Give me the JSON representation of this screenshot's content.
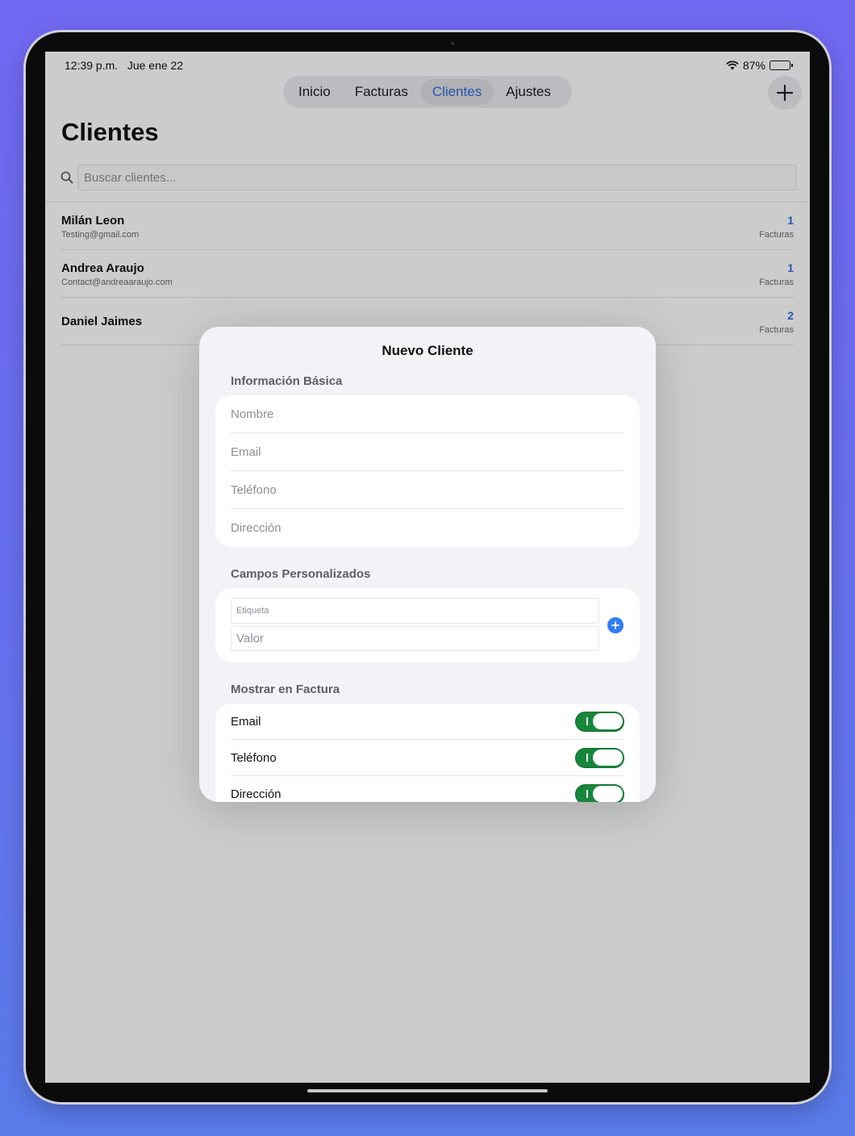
{
  "status_bar": {
    "time": "12:39 p.m.",
    "date": "Jue ene 22",
    "battery": "87%",
    "battery_level": 0.87
  },
  "nav": {
    "tabs": [
      {
        "label": "Inicio",
        "active": false
      },
      {
        "label": "Facturas",
        "active": false
      },
      {
        "label": "Clientes",
        "active": true
      },
      {
        "label": "Ajustes",
        "active": false
      }
    ],
    "add_icon": "plus-icon"
  },
  "page": {
    "title": "Clientes",
    "search_placeholder": "Buscar clientes..."
  },
  "clients": [
    {
      "name": "Milán Leon",
      "email": "Testing@gmail.com",
      "count": "1",
      "count_label": "Facturas"
    },
    {
      "name": "Andrea Araujo",
      "email": "Contact@andreaaraujo.com",
      "count": "1",
      "count_label": "Facturas"
    },
    {
      "name": "Daniel Jaimes",
      "email": "",
      "count": "2",
      "count_label": "Facturas"
    }
  ],
  "modal": {
    "title": "Nuevo Cliente",
    "basic_section": "Información Básica",
    "basic_fields": {
      "nombre": "Nombre",
      "email": "Email",
      "telefono": "Teléfono",
      "direccion": "Dirección"
    },
    "custom_section": "Campos Personalizados",
    "custom_fields": {
      "label_placeholder": "Etiqueta",
      "value_placeholder": "Valor"
    },
    "invoice_section": "Mostrar en Factura",
    "toggles": [
      {
        "label": "Email",
        "on": true
      },
      {
        "label": "Teléfono",
        "on": true
      },
      {
        "label": "Dirección",
        "on": true
      }
    ]
  },
  "colors": {
    "accent": "#2d6bd6",
    "toggle_on": "#17873b",
    "add_button": "#2f7cf6",
    "sheet_background": "#f2f2f7",
    "background_gradient_top": "#7168f2",
    "background_gradient_bottom": "#5a7bea"
  }
}
